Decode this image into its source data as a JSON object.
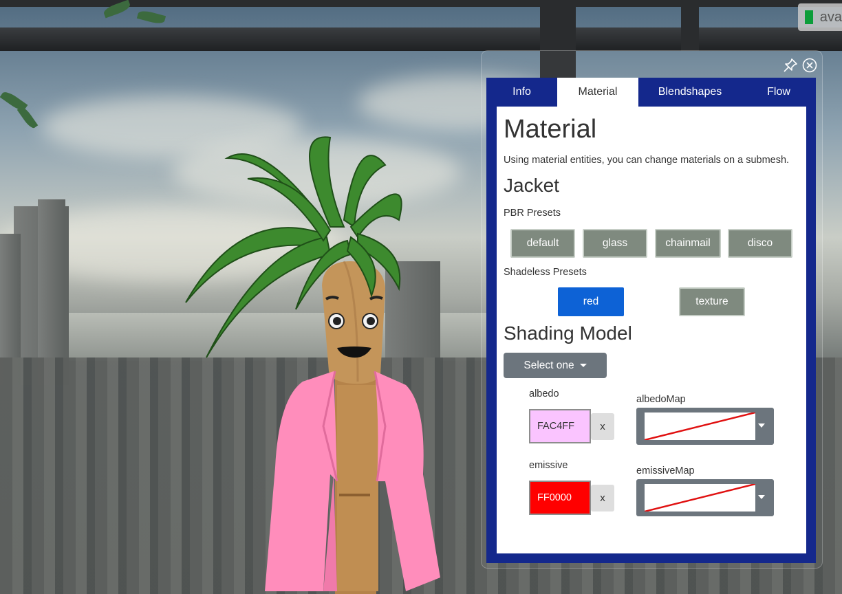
{
  "user_badge": {
    "name": "ava"
  },
  "tabs": [
    {
      "label": "Info"
    },
    {
      "label": "Material"
    },
    {
      "label": "Blendshapes"
    },
    {
      "label": "Flow"
    }
  ],
  "content": {
    "title": "Material",
    "description": "Using material entities, you can change materials on a submesh.",
    "section_title": "Jacket",
    "pbr_label": "PBR Presets",
    "pbr_presets": [
      "default",
      "glass",
      "chainmail",
      "disco"
    ],
    "shadeless_label": "Shadeless Presets",
    "shadeless_presets": [
      "red",
      "texture"
    ],
    "shading_title": "Shading Model",
    "shading_select": "Select one",
    "albedo": {
      "label": "albedo",
      "value": "FAC4FF",
      "color": "#FAC4FF",
      "clear": "x"
    },
    "albedo_map": {
      "label": "albedoMap"
    },
    "emissive": {
      "label": "emissive",
      "value": "FF0000",
      "color": "#FF0000",
      "clear": "x"
    },
    "emissive_map": {
      "label": "emissiveMap"
    }
  },
  "colors": {
    "panel_bg": "#14288c",
    "primary_button": "#0d62d6",
    "preset_button": "#7f8a7f",
    "jacket": "#ff8dbb"
  },
  "icons": {
    "pin": "pin-icon",
    "close": "close-icon"
  }
}
